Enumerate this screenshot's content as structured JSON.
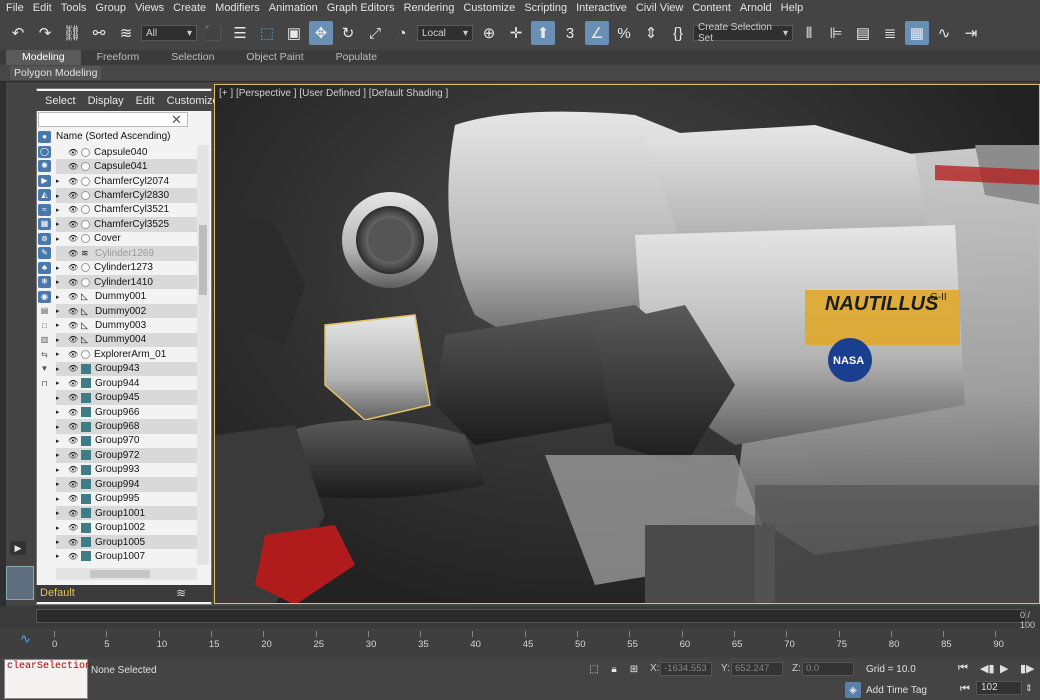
{
  "menu": [
    "File",
    "Edit",
    "Tools",
    "Group",
    "Views",
    "Create",
    "Modifiers",
    "Animation",
    "Graph Editors",
    "Rendering",
    "Customize",
    "Scripting",
    "Interactive",
    "Civil View",
    "Content",
    "Arnold",
    "Help"
  ],
  "toolbar": {
    "filter_value": "All",
    "refcoord_value": "Local",
    "selection_set_value": "Create Selection Set"
  },
  "tabs": [
    "Modeling",
    "Freeform",
    "Selection",
    "Object Paint",
    "Populate"
  ],
  "ribbon_label": "Polygon Modeling",
  "scene_explorer": {
    "menu": [
      "Select",
      "Display",
      "Edit",
      "Customize"
    ],
    "header": "Name (Sorted Ascending)",
    "rows": [
      {
        "name": "Capsule040",
        "kind": "dot",
        "tri": false
      },
      {
        "name": "Capsule041",
        "kind": "dot",
        "tri": false
      },
      {
        "name": "ChamferCyl2074",
        "kind": "dot",
        "tri": true
      },
      {
        "name": "ChamferCyl2830",
        "kind": "dot",
        "tri": true
      },
      {
        "name": "ChamferCyl3521",
        "kind": "dot",
        "tri": true
      },
      {
        "name": "ChamferCyl3525",
        "kind": "dot",
        "tri": true
      },
      {
        "name": "Cover",
        "kind": "dot",
        "tri": true
      },
      {
        "name": "Cylinder1269",
        "kind": "stack",
        "tri": false,
        "dim": true
      },
      {
        "name": "Cylinder1273",
        "kind": "dot",
        "tri": true
      },
      {
        "name": "Cylinder1410",
        "kind": "dot",
        "tri": true
      },
      {
        "name": "Dummy001",
        "kind": "dummy",
        "tri": true
      },
      {
        "name": "Dummy002",
        "kind": "dummy",
        "tri": true
      },
      {
        "name": "Dummy003",
        "kind": "dummy",
        "tri": true
      },
      {
        "name": "Dummy004",
        "kind": "dummy",
        "tri": true
      },
      {
        "name": "ExplorerArm_01",
        "kind": "dot",
        "tri": true
      },
      {
        "name": "Group943",
        "kind": "group",
        "tri": true
      },
      {
        "name": "Group944",
        "kind": "group",
        "tri": true
      },
      {
        "name": "Group945",
        "kind": "group",
        "tri": true
      },
      {
        "name": "Group966",
        "kind": "group",
        "tri": true
      },
      {
        "name": "Group968",
        "kind": "group",
        "tri": true
      },
      {
        "name": "Group970",
        "kind": "group",
        "tri": true
      },
      {
        "name": "Group972",
        "kind": "group",
        "tri": true
      },
      {
        "name": "Group993",
        "kind": "group",
        "tri": true
      },
      {
        "name": "Group994",
        "kind": "group",
        "tri": true
      },
      {
        "name": "Group995",
        "kind": "group",
        "tri": true
      },
      {
        "name": "Group1001",
        "kind": "group",
        "tri": true
      },
      {
        "name": "Group1002",
        "kind": "group",
        "tri": true
      },
      {
        "name": "Group1005",
        "kind": "group",
        "tri": true
      },
      {
        "name": "Group1007",
        "kind": "group",
        "tri": true
      }
    ],
    "layer": "Default"
  },
  "viewport": {
    "label": "[+ ]  [Perspective ]  [User Defined ]  [Default Shading ]",
    "decal_text": "NAUTILLUS",
    "decal_sub": "G-II",
    "badge": "NASA"
  },
  "timeline": {
    "frame_label": "0 / 100",
    "ticks": [
      "0",
      "5",
      "10",
      "15",
      "20",
      "25",
      "30",
      "35",
      "40",
      "45",
      "50",
      "55",
      "60",
      "65",
      "70",
      "75",
      "80",
      "85",
      "90"
    ]
  },
  "status": {
    "maxscript": "clearSelection",
    "selection": "None Selected",
    "x_label": "X:",
    "x_value": "-1634.553",
    "y_label": "Y:",
    "y_value": "652.247",
    "z_label": "Z:",
    "z_value": "0.0",
    "grid": "Grid = 10.0",
    "add_time_tag": "Add Time Tag",
    "current_frame": "102"
  }
}
